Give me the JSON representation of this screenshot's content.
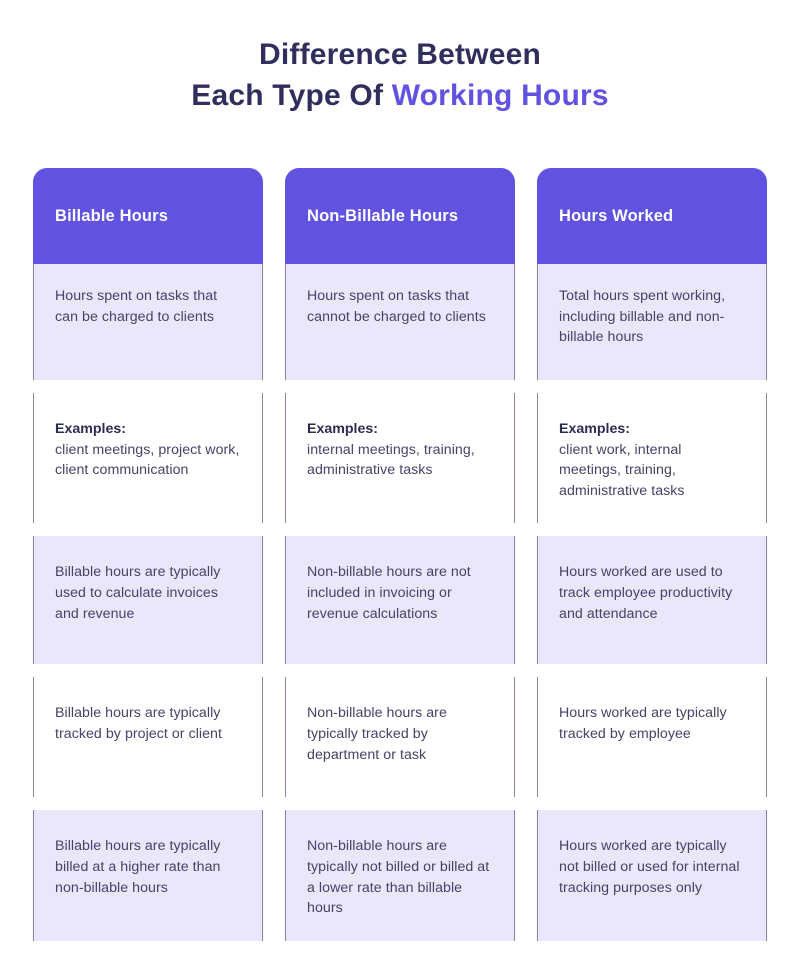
{
  "title": {
    "line1": "Difference Between",
    "line2_prefix": "Each Type Of ",
    "line2_accent": "Working Hours"
  },
  "colors": {
    "accent_purple": "#6152e0",
    "header_text": "#312e5e",
    "lavender_fill": "#eae7fb",
    "border_line": "#6f6ea1",
    "body_text": "#464268",
    "page_background": "#ffffff"
  },
  "columns": [
    {
      "header": "Billable Hours",
      "description": "Hours spent on tasks that can be charged to clients"
    },
    {
      "header": "Non-Billable Hours",
      "description": "Hours spent on tasks that cannot be charged to clients"
    },
    {
      "header": "Hours Worked",
      "description": "Total hours spent working, including billable and non-billable hours"
    }
  ],
  "examples_label": "Examples:",
  "rows": [
    {
      "style": "white",
      "has_label": true,
      "cells": [
        "client meetings, project work, client communication",
        "internal meetings, training, administrative tasks",
        "client work, internal meetings, training, administrative tasks"
      ]
    },
    {
      "style": "lavender",
      "has_label": false,
      "cells": [
        "Billable hours are typically used to calculate invoices and revenue",
        "Non-billable hours are not included in invoicing or revenue calculations",
        "Hours worked are used to track employee productivity and attendance"
      ]
    },
    {
      "style": "white",
      "has_label": false,
      "cells": [
        "Billable hours are typically tracked by project or client",
        "Non-billable hours are typically tracked by department or task",
        "Hours worked are typically tracked by employee"
      ]
    },
    {
      "style": "lavender",
      "has_label": false,
      "cells": [
        "Billable hours are typically billed at a higher rate than non-billable hours",
        "Non-billable hours are typically not billed or billed at a lower rate than billable hours",
        "Hours worked are typically not billed or used for internal tracking purposes only"
      ]
    }
  ]
}
